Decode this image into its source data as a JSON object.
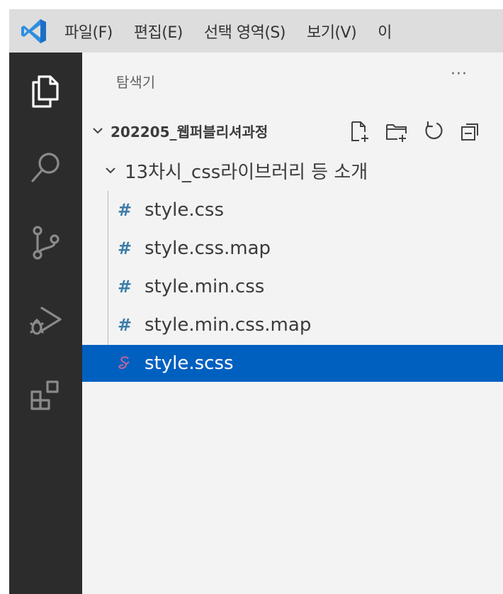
{
  "menu": {
    "items": [
      "파일(F)",
      "편집(E)",
      "선택 영역(S)",
      "보기(V)",
      "이"
    ]
  },
  "activity_bar": {
    "icons": [
      "explorer-icon",
      "search-icon",
      "source-control-icon",
      "run-debug-icon",
      "extensions-icon"
    ]
  },
  "sidebar": {
    "title": "탐색기",
    "more": "···",
    "root": {
      "label": "202205_웹퍼블리셔과정",
      "actions": [
        "new-file-icon",
        "new-folder-icon",
        "refresh-icon",
        "collapse-all-icon"
      ]
    },
    "folder": {
      "label": "13차시_css라이브러리 등 소개"
    },
    "files": [
      {
        "name": "style.css",
        "icon": "#"
      },
      {
        "name": "style.css.map",
        "icon": "#"
      },
      {
        "name": "style.min.css",
        "icon": "#"
      },
      {
        "name": "style.min.css.map",
        "icon": "#"
      },
      {
        "name": "style.scss",
        "icon": "sass-icon"
      }
    ]
  },
  "colors": {
    "selection": "#0060c0",
    "css_icon": "#3d7da8",
    "sass_icon": "#cd6799",
    "activity_bar": "#2c2c2c",
    "vscode_blue": "#2f8ee0"
  }
}
